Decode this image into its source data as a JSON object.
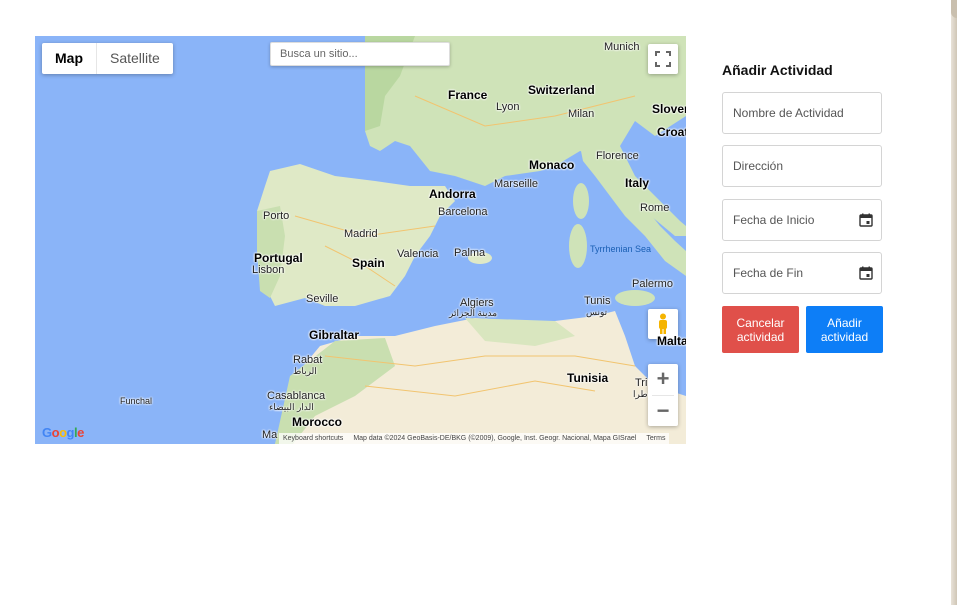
{
  "map": {
    "type_buttons": [
      "Map",
      "Satellite"
    ],
    "search_placeholder": "Busca un sitio...",
    "labels": {
      "france": "France",
      "switzerland": "Switzerland",
      "munich": "Munich",
      "lyon": "Lyon",
      "milan": "Milan",
      "slovenia": "Slover",
      "croatia": "Croat",
      "monaco": "Monaco",
      "florence": "Florence",
      "marseille": "Marseille",
      "andorra": "Andorra",
      "italy": "Italy",
      "rome": "Rome",
      "porto": "Porto",
      "barcelona": "Barcelona",
      "madrid": "Madrid",
      "portugal": "Portugal",
      "lisbon": "Lisbon",
      "spain": "Spain",
      "valencia": "Valencia",
      "palma": "Palma",
      "tyrrhenian": "Tyrrhenian Sea",
      "palermo": "Palermo",
      "seville": "Seville",
      "algiers": "Algiers",
      "algiers_ar": "مدينة الجزائر",
      "tunis": "Tunis",
      "tunis_ar": "تونس",
      "gibraltar": "Gibraltar",
      "malta": "Malta",
      "rabat": "Rabat",
      "rabat_ar": "الرباط",
      "tunisia": "Tunisia",
      "tripoli": "Tri",
      "tripoli_ar": "طرا",
      "funchal": "Funchal",
      "casablanca": "Casablanca",
      "casablanca_ar": "الدار البيضاء",
      "morocco": "Morocco",
      "marrakesh": "Ma"
    },
    "footer": {
      "shortcuts": "Keyboard shortcuts",
      "attribution": "Map data ©2024 GeoBasis-DE/BKG (©2009), Google, Inst. Geogr. Nacional, Mapa GISrael",
      "terms": "Terms"
    },
    "logo": "Google"
  },
  "form": {
    "title": "Añadir Actividad",
    "activity_name_placeholder": "Nombre de Actividad",
    "address_placeholder": "Dirección",
    "start_date_placeholder": "Fecha de Inicio",
    "end_date_placeholder": "Fecha de Fin",
    "cancel_label": "Cancelar actividad",
    "add_label": "Añadir actividad"
  }
}
